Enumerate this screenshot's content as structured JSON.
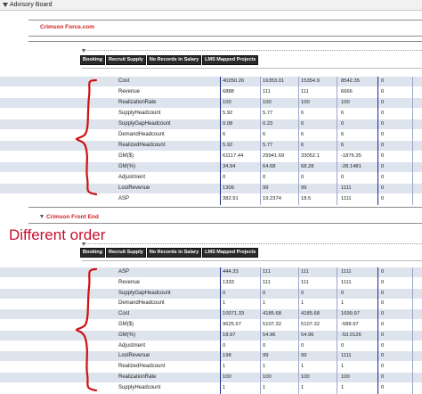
{
  "header": {
    "title": "Advisory Board"
  },
  "section1": {
    "title": "Crimson Force.com"
  },
  "section2": {
    "title": "Crimson Front End"
  },
  "buttons": [
    "Booking",
    "Recruit Supply",
    "No Records in Salary",
    "LMS Mapped Projects"
  ],
  "annotation": "Different order",
  "table1": [
    {
      "label": "Cost",
      "values": [
        "40250.26",
        "16353.01",
        "15354.9",
        "8542.35",
        "0"
      ]
    },
    {
      "label": "Revenue",
      "values": [
        "6888",
        "111",
        "111",
        "6666",
        "0"
      ]
    },
    {
      "label": "RealizationRate",
      "values": [
        "100",
        "100",
        "100",
        "100",
        "0"
      ]
    },
    {
      "label": "SupplyHeadcount",
      "values": [
        "5.92",
        "5.77",
        "6",
        "6",
        "0"
      ]
    },
    {
      "label": "SupplyGapHeadcount",
      "values": [
        "0.08",
        "0.23",
        "0",
        "0",
        "0"
      ]
    },
    {
      "label": "DemandHeadcount",
      "values": [
        "6",
        "6",
        "6",
        "6",
        "0"
      ]
    },
    {
      "label": "RealizedHeadcount",
      "values": [
        "5.92",
        "5.77",
        "6",
        "6",
        "0"
      ]
    },
    {
      "label": "GM($)",
      "values": [
        "61117.44",
        "29941.69",
        "33052.1",
        "-1876.35",
        "0"
      ]
    },
    {
      "label": "GM(%)",
      "values": [
        "34.94",
        "64.68",
        "68.28",
        "-28.1481",
        "0"
      ]
    },
    {
      "label": "Adjustment",
      "values": [
        "0",
        "0",
        "0",
        "0",
        "0"
      ]
    },
    {
      "label": "LostRevenue",
      "values": [
        "1309",
        "99",
        "99",
        "1111",
        "0"
      ]
    },
    {
      "label": "ASP",
      "values": [
        "382.91",
        "19.2374",
        "18.5",
        "1111",
        "0"
      ]
    }
  ],
  "table2": [
    {
      "label": "ASP",
      "values": [
        "444.33",
        "111",
        "111",
        "1111",
        "0"
      ]
    },
    {
      "label": "Revenue",
      "values": [
        "1333",
        "111",
        "111",
        "1111",
        "0"
      ]
    },
    {
      "label": "SupplyGapHeadcount",
      "values": [
        "0",
        "0",
        "0",
        "0",
        "0"
      ]
    },
    {
      "label": "DemandHeadcount",
      "values": [
        "1",
        "1",
        "1",
        "1",
        "0"
      ]
    },
    {
      "label": "Cost",
      "values": [
        "10071.33",
        "4185.68",
        "4185.68",
        "1699.97",
        "0"
      ]
    },
    {
      "label": "GM($)",
      "values": [
        "9625.67",
        "5107.32",
        "5107.32",
        "-588.97",
        "0"
      ]
    },
    {
      "label": "GM(%)",
      "values": [
        "18.97",
        "54.96",
        "54.96",
        "-53.0126",
        "0"
      ]
    },
    {
      "label": "Adjustment",
      "values": [
        "0",
        "0",
        "0",
        "0",
        "0"
      ]
    },
    {
      "label": "LostRevenue",
      "values": [
        "198",
        "99",
        "99",
        "1111",
        "0"
      ]
    },
    {
      "label": "RealizedHeadcount",
      "values": [
        "1",
        "1",
        "1",
        "1",
        "0"
      ]
    },
    {
      "label": "RealizationRate",
      "values": [
        "100",
        "100",
        "100",
        "100",
        "0"
      ]
    },
    {
      "label": "SupplyHeadcount",
      "values": [
        "1",
        "1",
        "1",
        "1",
        "0"
      ]
    }
  ]
}
